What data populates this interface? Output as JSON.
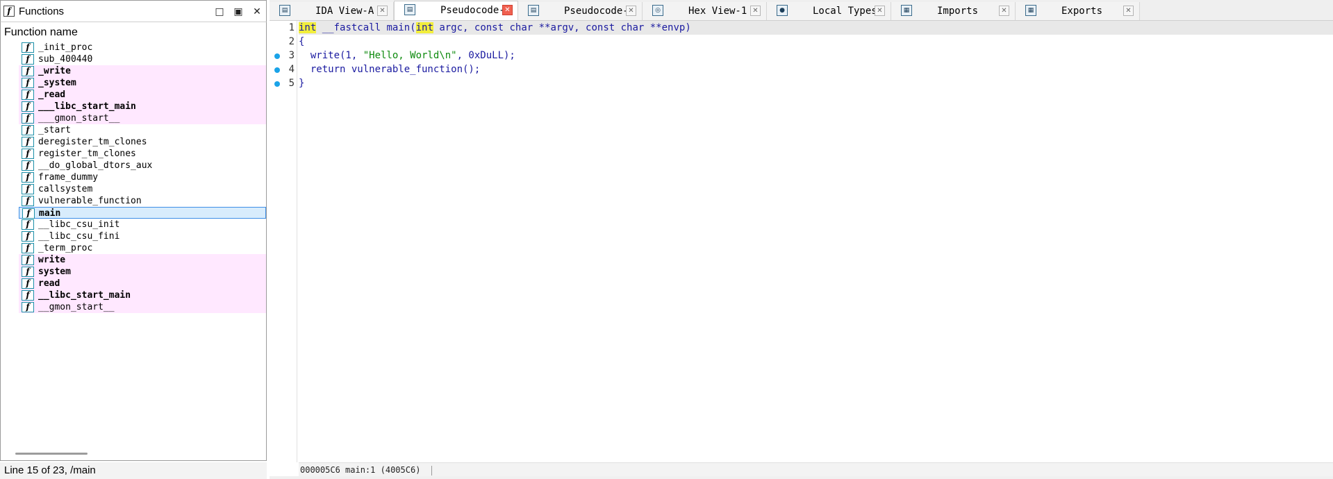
{
  "functions_panel": {
    "title": "Functions",
    "column_header": "Function name",
    "status": "Line 15 of 23, /main",
    "controls": {
      "maximize": "□",
      "restore": "▣",
      "close": "✕"
    },
    "icon_letter": "f",
    "items": [
      {
        "name": "_init_proc",
        "lib": false,
        "bold": false,
        "selected": false
      },
      {
        "name": "sub_400440",
        "lib": false,
        "bold": false,
        "selected": false
      },
      {
        "name": "_write",
        "lib": true,
        "bold": true,
        "selected": false
      },
      {
        "name": "_system",
        "lib": true,
        "bold": true,
        "selected": false
      },
      {
        "name": "_read",
        "lib": true,
        "bold": true,
        "selected": false
      },
      {
        "name": "___libc_start_main",
        "lib": true,
        "bold": true,
        "selected": false
      },
      {
        "name": "___gmon_start__",
        "lib": true,
        "bold": false,
        "selected": false
      },
      {
        "name": "_start",
        "lib": false,
        "bold": false,
        "selected": false
      },
      {
        "name": "deregister_tm_clones",
        "lib": false,
        "bold": false,
        "selected": false
      },
      {
        "name": "register_tm_clones",
        "lib": false,
        "bold": false,
        "selected": false
      },
      {
        "name": "__do_global_dtors_aux",
        "lib": false,
        "bold": false,
        "selected": false
      },
      {
        "name": "frame_dummy",
        "lib": false,
        "bold": false,
        "selected": false
      },
      {
        "name": "callsystem",
        "lib": false,
        "bold": false,
        "selected": false
      },
      {
        "name": "vulnerable_function",
        "lib": false,
        "bold": false,
        "selected": false
      },
      {
        "name": "main",
        "lib": false,
        "bold": true,
        "selected": true
      },
      {
        "name": "__libc_csu_init",
        "lib": false,
        "bold": false,
        "selected": false
      },
      {
        "name": "__libc_csu_fini",
        "lib": false,
        "bold": false,
        "selected": false
      },
      {
        "name": "_term_proc",
        "lib": false,
        "bold": false,
        "selected": false
      },
      {
        "name": "write",
        "lib": true,
        "bold": true,
        "selected": false
      },
      {
        "name": "system",
        "lib": true,
        "bold": true,
        "selected": false
      },
      {
        "name": "read",
        "lib": true,
        "bold": true,
        "selected": false
      },
      {
        "name": "__libc_start_main",
        "lib": true,
        "bold": true,
        "selected": false
      },
      {
        "name": "__gmon_start__",
        "lib": true,
        "bold": false,
        "selected": false
      }
    ]
  },
  "tabs": [
    {
      "label": "IDA View-A",
      "icon": "ida-view-icon",
      "icon_glyph": "▤",
      "active": false
    },
    {
      "label": "Pseudocode-B",
      "icon": "pseudocode-icon",
      "icon_glyph": "▤",
      "active": true
    },
    {
      "label": "Pseudocode-A",
      "icon": "pseudocode-icon",
      "icon_glyph": "▤",
      "active": false
    },
    {
      "label": "Hex View-1",
      "icon": "hex-view-icon",
      "icon_glyph": "◎",
      "active": false
    },
    {
      "label": "Local Types",
      "icon": "local-types-icon",
      "icon_glyph": "●",
      "active": false
    },
    {
      "label": "Imports",
      "icon": "imports-icon",
      "icon_glyph": "▦",
      "active": false
    },
    {
      "label": "Exports",
      "icon": "exports-icon",
      "icon_glyph": "▦",
      "active": false
    }
  ],
  "tab_close_glyph": "✕",
  "code": {
    "line_numbers": [
      "1",
      "2",
      "3",
      "4",
      "5"
    ],
    "breakpoint_lines": [
      3,
      4,
      5
    ],
    "line1": {
      "kw1": "int",
      "part1": " __fastcall main(",
      "kw2": "int",
      "part2": " argc, const char **argv, const char **envp)"
    },
    "line2": "{",
    "line3": {
      "indent": "  ",
      "part1": "write(1, ",
      "string": "\"Hello, World\\n\"",
      "part2": ", 0xDuLL);"
    },
    "line4": "  return vulnerable_function();",
    "line5": "}"
  },
  "code_status": {
    "address": "000005C6",
    "location": "main:1",
    "va": "(4005C6)"
  },
  "colors": {
    "lib_function_bg": "#ffe8ff",
    "selected_bg": "#d8ecfc",
    "keyword_highlight": "#f2ee3c",
    "code_text": "#1a1aa0",
    "string_text": "#0d8a0d",
    "breakpoint": "#1aa3e8",
    "active_tab_close": "#f06050"
  }
}
